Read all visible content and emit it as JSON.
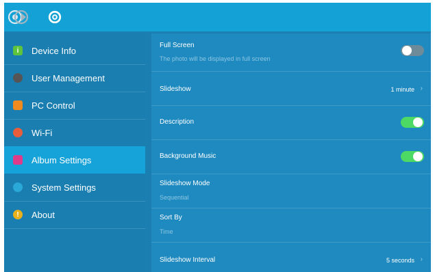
{
  "header": {
    "logo_icon": "photo-frame-logo-icon",
    "settings_icon": "gear-icon"
  },
  "sidebar": {
    "items": [
      {
        "label": "Device Info",
        "icon": "info-icon",
        "color": "#5cc33b"
      },
      {
        "label": "User Management",
        "icon": "user-icon",
        "color": "#555555"
      },
      {
        "label": "PC Control",
        "icon": "monitor-icon",
        "color": "#ef8a1e"
      },
      {
        "label": "Wi-Fi",
        "icon": "wifi-icon",
        "color": "#e95d3a"
      },
      {
        "label": "Album Settings",
        "icon": "album-icon",
        "color": "#e03b8a",
        "active": true
      },
      {
        "label": "System Settings",
        "icon": "settings-icon",
        "color": "#2aa8d8"
      },
      {
        "label": "About",
        "icon": "alert-icon",
        "color": "#e8b11c"
      }
    ]
  },
  "settings": {
    "full_screen": {
      "title": "Full Screen",
      "subtitle": "The photo will be displayed in full screen",
      "enabled": false
    },
    "slideshow": {
      "title": "Slideshow",
      "value": "1 minute"
    },
    "description": {
      "title": "Description",
      "enabled": true
    },
    "background_music": {
      "title": "Background Music",
      "enabled": true
    },
    "slideshow_mode": {
      "title": "Slideshow Mode",
      "value": "Sequential"
    },
    "sort_by": {
      "title": "Sort By",
      "value": "Time"
    },
    "slideshow_interval": {
      "title": "Slideshow Interval",
      "value": "5 seconds"
    }
  },
  "colors": {
    "accent": "#14a2d6",
    "background": "#1b7fb1",
    "toggle_on": "#4cd964",
    "toggle_off": "#6e8b99"
  }
}
